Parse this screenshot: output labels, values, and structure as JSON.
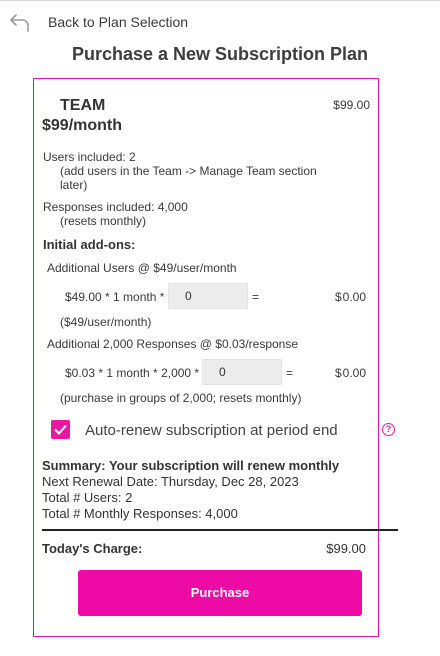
{
  "nav": {
    "back_label": "Back to Plan Selection"
  },
  "page": {
    "title": "Purchase a New Subscription Plan"
  },
  "plan": {
    "name": "TEAM",
    "price_label": "$99/month",
    "amount": "$99.00",
    "users_included": "Users included: 2",
    "users_note": "(add users in the Team -> Manage Team section later)",
    "responses_included": "Responses included: 4,000",
    "responses_note": "(resets monthly)"
  },
  "addons": {
    "heading": "Initial add-ons:",
    "users": {
      "title": "Additional Users @ $49/user/month",
      "formula": "$49.00 * 1 month *",
      "input_value": "0",
      "equals": "=",
      "currency": "$",
      "total": "0.00",
      "note": "($49/user/month)"
    },
    "responses": {
      "title": "Additional 2,000 Responses @ $0.03/response",
      "formula": "$0.03 * 1 month * 2,000 *",
      "input_value": "0",
      "equals": "=",
      "currency": "$",
      "total": "0.00",
      "note": "(purchase in groups of 2,000; resets monthly)"
    }
  },
  "auto_renew": {
    "label": "Auto-renew subscription at period end",
    "checked": true,
    "help_icon": "question-circle-icon"
  },
  "summary": {
    "heading": "Summary: Your subscription will renew monthly",
    "renewal": "Next Renewal Date: Thursday, Dec 28, 2023",
    "users": "Total # Users: 2",
    "responses": "Total # Monthly Responses: 4,000"
  },
  "charge": {
    "label": "Today's Charge:",
    "amount": "$99.00"
  },
  "actions": {
    "purchase_label": "Purchase"
  },
  "colors": {
    "accent": "#ED0AA5",
    "card_border": "#D21CA0"
  }
}
